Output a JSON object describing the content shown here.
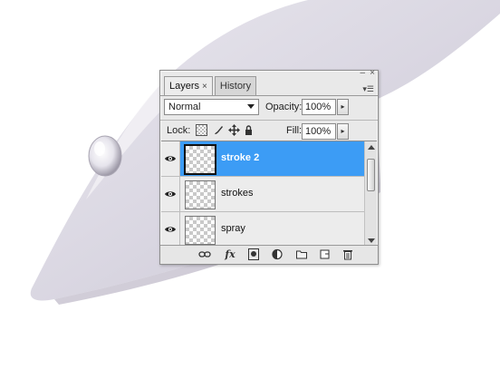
{
  "panel": {
    "tabs": [
      {
        "label": "Layers",
        "close": "×",
        "active": true
      },
      {
        "label": "History",
        "active": false
      }
    ],
    "window_minimize": "–",
    "window_close": "×",
    "menu_glyph": "▾☰"
  },
  "controls": {
    "blend_mode": "Normal",
    "opacity_label": "Opacity:",
    "opacity_value": "100%",
    "lock_label": "Lock:",
    "fill_label": "Fill:",
    "fill_value": "100%",
    "stepper_glyph": "▸"
  },
  "layers": [
    {
      "name": "stroke 2",
      "visible": true,
      "selected": true
    },
    {
      "name": "strokes",
      "visible": true,
      "selected": false
    },
    {
      "name": "spray",
      "visible": true,
      "selected": false
    }
  ],
  "footer": {
    "fx_label": "fx"
  },
  "icons": {
    "eye": "eye-icon",
    "lock_transparency": "lock-transparency-icon",
    "lock_brush": "brush-icon",
    "lock_move": "move-icon",
    "lock_all": "lock-icon"
  },
  "colors": {
    "selection": "#3c9cf5",
    "panel_bg": "#e9e9e9"
  }
}
